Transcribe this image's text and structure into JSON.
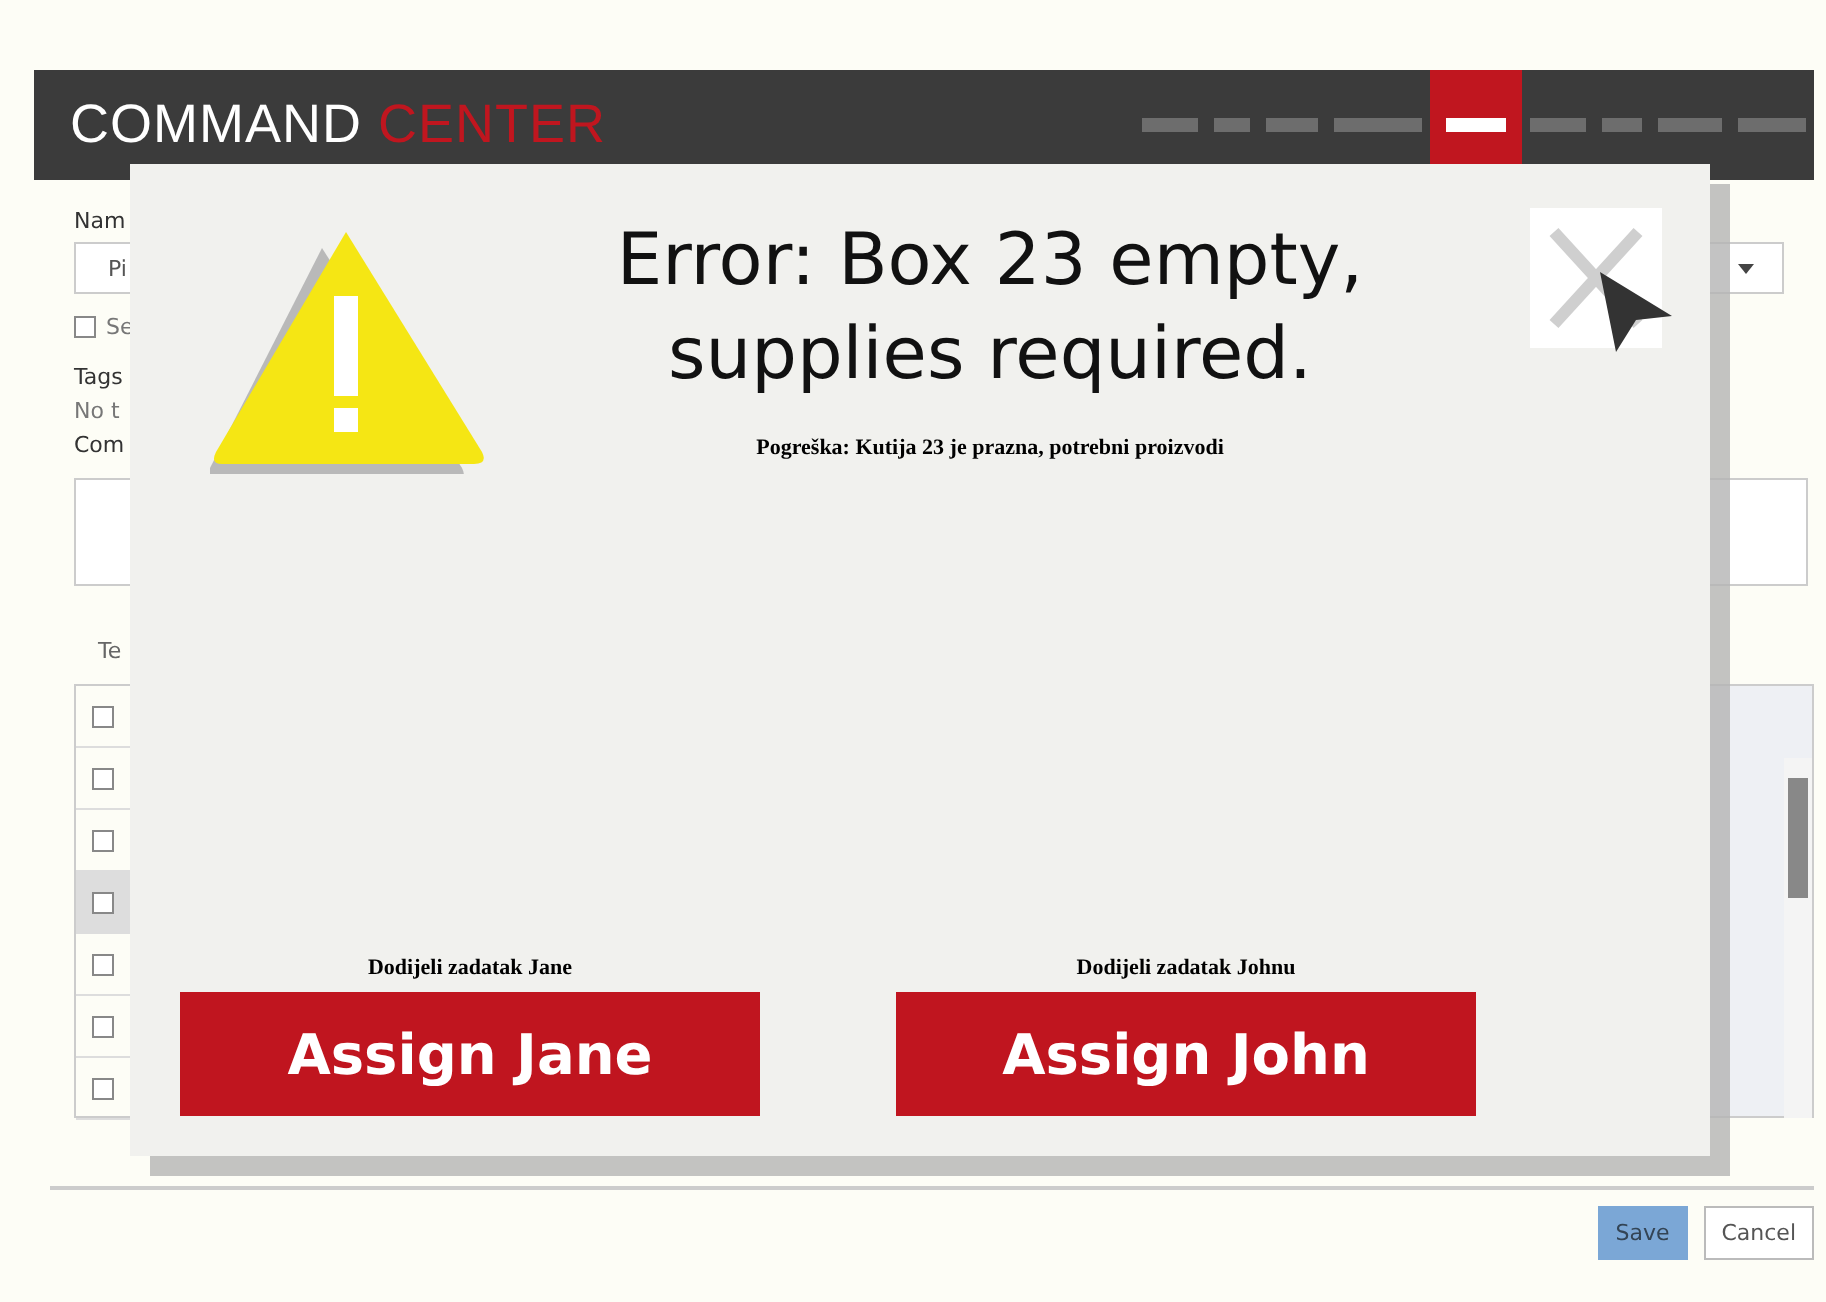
{
  "header": {
    "logo_primary": "COMMAND",
    "logo_accent": "CENTER",
    "nav": [
      {
        "selected": false
      },
      {
        "selected": false
      },
      {
        "selected": false
      },
      {
        "selected": false
      },
      {
        "selected": true
      },
      {
        "selected": false
      },
      {
        "selected": false
      },
      {
        "selected": false
      },
      {
        "selected": false
      }
    ]
  },
  "form": {
    "name_label": "Nam",
    "name_value": "Pi",
    "selectable": {
      "label": "Se",
      "checked": false
    },
    "tags_label": "Tags",
    "tags_value": "No t",
    "comment_label": "Com"
  },
  "tabs": [
    {
      "label": "Te",
      "selected": false
    }
  ],
  "table": {
    "select_all_checked": false,
    "rows": [
      {
        "selected": false
      },
      {
        "selected": false
      },
      {
        "selected": true
      },
      {
        "selected": false
      },
      {
        "selected": false
      },
      {
        "selected": false
      }
    ]
  },
  "footer": {
    "buttons": [
      {
        "label": "Save",
        "kind": "primary"
      },
      {
        "label": "Cancel",
        "kind": "secondary"
      }
    ]
  },
  "dialog": {
    "title": "Error: Box 23 empty, supplies required.",
    "subtitle": "Pogreška: Kutija 23 je prazna, potrebni proizvodi",
    "actions": [
      {
        "caption": "Dodijeli zadatak Jane",
        "label": "Assign Jane"
      },
      {
        "caption": "Dodijeli zadatak Johnu",
        "label": "Assign John"
      }
    ]
  }
}
